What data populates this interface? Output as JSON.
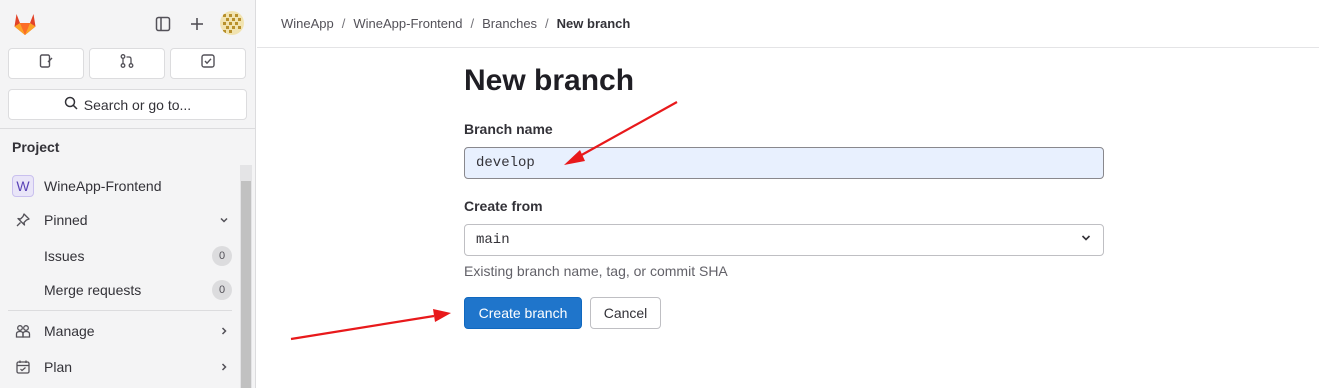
{
  "sidebar": {
    "search_placeholder": "Search or go to...",
    "section_title": "Project",
    "project_name": "WineApp-Frontend",
    "project_initial": "W",
    "items": [
      {
        "label": "Pinned",
        "icon": "pin-icon"
      },
      {
        "label": "Issues",
        "count": "0"
      },
      {
        "label": "Merge requests",
        "count": "0"
      },
      {
        "label": "Manage",
        "icon": "users-icon"
      },
      {
        "label": "Plan",
        "icon": "calendar-icon"
      }
    ]
  },
  "breadcrumb": [
    "WineApp",
    "WineApp-Frontend",
    "Branches",
    "New branch"
  ],
  "page": {
    "title": "New branch",
    "branch_name_label": "Branch name",
    "branch_name_value": "develop",
    "create_from_label": "Create from",
    "create_from_value": "main",
    "create_from_help": "Existing branch name, tag, or commit SHA",
    "create_button": "Create branch",
    "cancel_button": "Cancel"
  },
  "colors": {
    "primary": "#1f75cb",
    "annotation_arrow": "#e8191b",
    "logo_orange": "#e24329"
  }
}
